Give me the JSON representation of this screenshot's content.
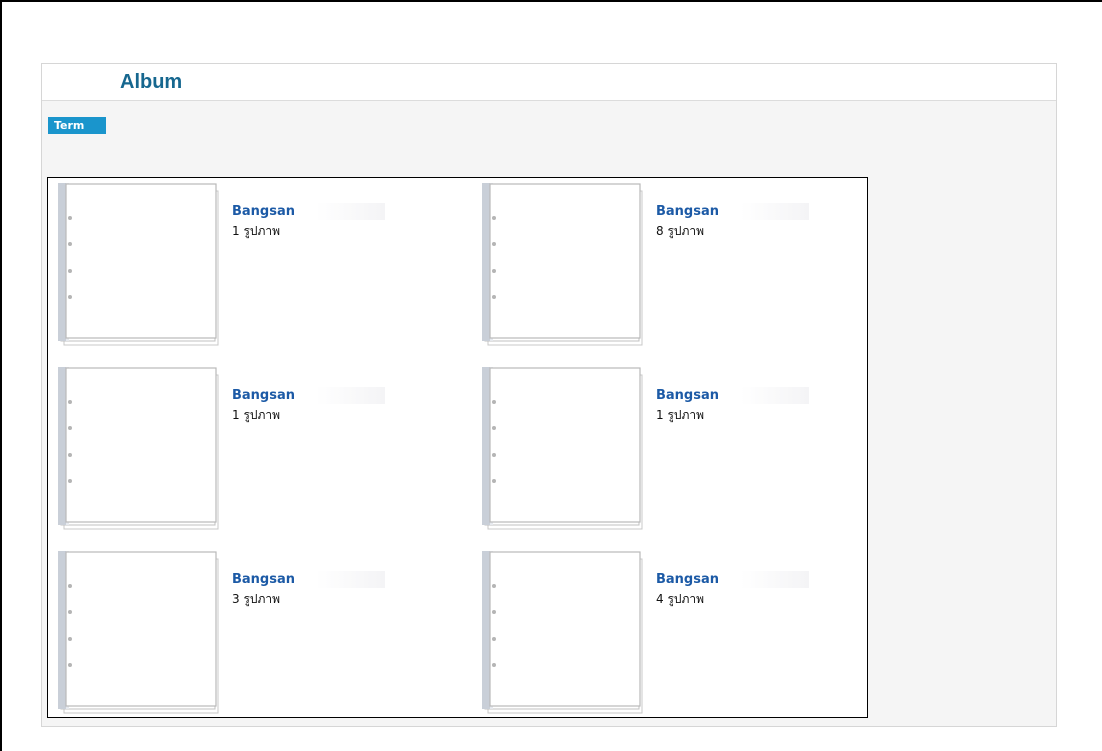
{
  "header": {
    "title": "Album"
  },
  "tabs": [
    {
      "label": "Term"
    }
  ],
  "albums": [
    {
      "name": "Bangsan",
      "count": "1 รูปภาพ"
    },
    {
      "name": "Bangsan",
      "count": "8 รูปภาพ"
    },
    {
      "name": "Bangsan",
      "count": "1 รูปภาพ"
    },
    {
      "name": "Bangsan",
      "count": "1 รูปภาพ"
    },
    {
      "name": "Bangsan",
      "count": "3 รูปภาพ"
    },
    {
      "name": "Bangsan",
      "count": "4 รูปภาพ"
    }
  ],
  "colors": {
    "title": "#16678f",
    "tab_bg": "#1a95cc",
    "album_name": "#1c5aa6",
    "panel_bg": "#f5f5f5"
  },
  "icons": {
    "album_thumb": "binder-album-icon"
  }
}
